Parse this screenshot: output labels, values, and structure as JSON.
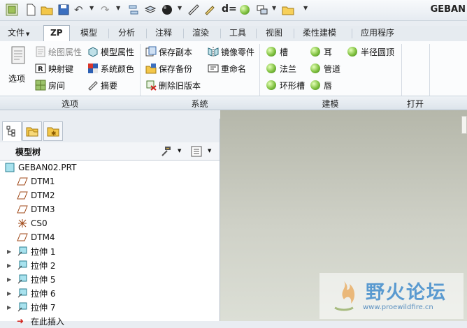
{
  "window": {
    "title": "GEBAN"
  },
  "menu_tabs": [
    "文件",
    "ZP",
    "模型",
    "分析",
    "注释",
    "渲染",
    "工具",
    "视图",
    "柔性建模",
    "应用程序"
  ],
  "ribbon": {
    "options_btn": "选项",
    "col1": [
      "绘图属性",
      "映射键",
      "房间"
    ],
    "col2": [
      "模型属性",
      "系统颜色",
      "摘要"
    ],
    "col3": [
      "保存副本",
      "保存备份",
      "删除旧版本"
    ],
    "col4": [
      "镜像零件",
      "重命名"
    ],
    "col5": [
      "槽",
      "法兰",
      "环形槽"
    ],
    "col6": [
      "耳",
      "管道",
      "唇"
    ],
    "col7": [
      "半径圆顶"
    ],
    "groups": [
      "选项",
      "系统",
      "建模",
      "打开"
    ]
  },
  "model_tree": {
    "header": "模型树",
    "items": [
      "GEBAN02.PRT",
      "DTM1",
      "DTM2",
      "DTM3",
      "CS0",
      "DTM4",
      "拉伸 1",
      "拉伸 2",
      "拉伸 5",
      "拉伸 6",
      "拉伸 7",
      "在此插入"
    ]
  },
  "watermark": {
    "name": "野火论坛",
    "url": "www.proewildfire.cn"
  }
}
